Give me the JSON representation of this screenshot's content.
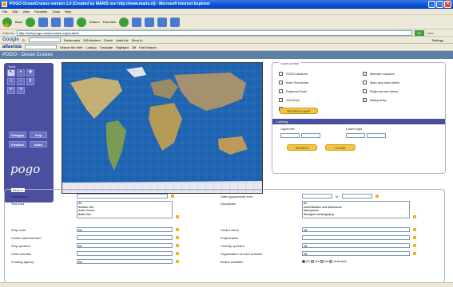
{
  "window": {
    "title": "POGO OceanCruises version 1.0 (Created by MARIS see http://www.maris.nl) - Microsoft Internet Explorer"
  },
  "menu": [
    "File",
    "Edit",
    "View",
    "Favorites",
    "Tools",
    "Help"
  ],
  "toolbar": {
    "back": "Back",
    "search": "Search",
    "favorites": "Favorites"
  },
  "address": {
    "label": "Address",
    "url": "http://www.pogo-oceancruises.org/cruises/",
    "go": "Go",
    "links": "Links"
  },
  "google": {
    "logo": "Google",
    "label": "G-",
    "bookmarks": "Bookmarks",
    "blocked": "285 blocked",
    "check": "Check",
    "autolink": "AutoLink",
    "sendto": "Send to",
    "settings": "Settings"
  },
  "altavista": {
    "logo": "altavista",
    "search_web": "Search the Web",
    "lookup": "Lookup",
    "translate": "Translate",
    "highlight": "Highlight",
    "off": "Off",
    "fast_search": "Fast Search"
  },
  "page": {
    "heading": "POGO - Ocean Cruises"
  },
  "tools": {
    "title": "Tools",
    "buttons": [
      "Datagap",
      "Help",
      "Position",
      "Index"
    ],
    "logo": "pogo"
  },
  "layer_control": {
    "title": "Layer control",
    "items": [
      {
        "label": "POGO stations",
        "checked": false
      },
      {
        "label": "Marsden squares",
        "checked": true
      },
      {
        "label": "Main Sea areas",
        "checked": false
      },
      {
        "label": "Main sea area labels",
        "checked": false
      },
      {
        "label": "Regional Seas",
        "checked": false
      },
      {
        "label": "Regional sea labels",
        "checked": false
      },
      {
        "label": "Grid lines",
        "checked": false
      },
      {
        "label": "Bathymetry",
        "checked": true
      },
      {
        "label": "Operator locations",
        "checked": false
      }
    ],
    "refresh_label": "REFRESH MAP",
    "latlong_title": "Lat/long",
    "upper_left": "Upper-left",
    "lower_right": "Lower-right",
    "search_btn": "SEARCH",
    "clear_btn": "CLEAR"
  },
  "search": {
    "title": "Search",
    "free_search": "Free search",
    "date_label": "Date (yyyymmdd) from",
    "date_to": "to",
    "sea_area": "Sea area",
    "sea_options": [
      "All",
      "Arabian Sea",
      "Arctic Ocean",
      "Baltic Sea"
    ],
    "disciplines": "Disciplines",
    "disc_options": [
      "All",
      "Administration and dimensions",
      "Atmosphere",
      "Biological oceanography"
    ],
    "ship_code": "Ship code",
    "ship_code_val": "All",
    "vessel_name": "Vessel name",
    "vessel_val": "All",
    "cruise_name": "Cruise name/number",
    "projectname": "Projectname",
    "ship_operator": "Ship operator",
    "ship_operator_val": "All",
    "country_operator": "Country operator",
    "country_val": "All",
    "chief_scientist": "Chief scientist",
    "org_chief": "Organisation of chief scientist",
    "org_val": "All",
    "funding": "Funding agency",
    "funding_val": "All",
    "berths": "Berths available",
    "berth_options": [
      "All",
      "Yes",
      "No",
      "Unknown"
    ]
  }
}
